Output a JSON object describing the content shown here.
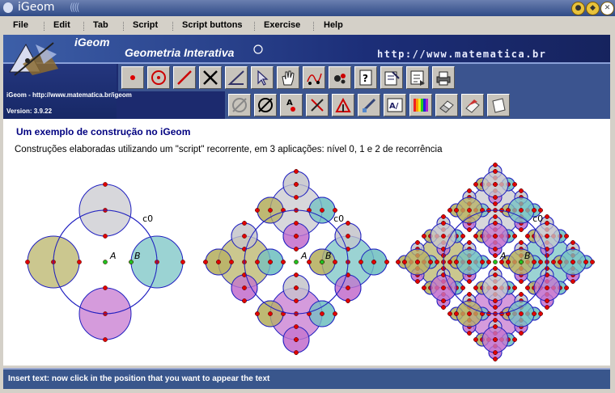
{
  "window": {
    "title": "iGeom",
    "minimize_label": "●",
    "maximize_label": "◆",
    "close_label": "✕"
  },
  "menu": [
    "File",
    "Edit",
    "Tab",
    "Script",
    "Script buttons",
    "Exercise",
    "Help"
  ],
  "header": {
    "app_name": "iGeom",
    "subtitle": "Geometria Interativa",
    "url_banner": "http://www.matematica.br",
    "url_small": "iGeom - http://www.matematica.br/igeom",
    "version": "Version: 3.9.22"
  },
  "toolbar_row1": [
    "point-icon",
    "circle-icon",
    "line-segment-icon",
    "intersection-icon",
    "angle-icon",
    "pointer-icon",
    "hand-icon",
    "locus-icon",
    "animation-icon",
    "script-help-icon",
    "record-script-icon",
    "run-script-icon",
    "printer-icon"
  ],
  "toolbar_row2": [
    "hide-icon",
    "show-hidden-icon",
    "text-label-icon",
    "delete-point-icon",
    "edit-point-icon",
    "brush-icon",
    "edit-text-icon",
    "color-palette-icon",
    "eraser-icon",
    "erase-all-icon",
    "clear-icon"
  ],
  "content": {
    "heading": "Um exemplo de construção no iGeom",
    "description": "Construções elaboradas utilizando um \"script\" recorrente, em 3 aplicações: nível 0, 1 e 2 de recorrência",
    "labels": {
      "circle": "c0",
      "point_a": "A",
      "point_b": "B"
    },
    "colors": {
      "gray": "#c9c9cf",
      "olive": "#b9b46a",
      "teal": "#7ac4c4",
      "purple": "#c77ad0",
      "blue": "#2020c0",
      "red": "#e00000",
      "green": "#20c020"
    }
  },
  "status": "Insert text: now click in the position that you want to appear the text"
}
